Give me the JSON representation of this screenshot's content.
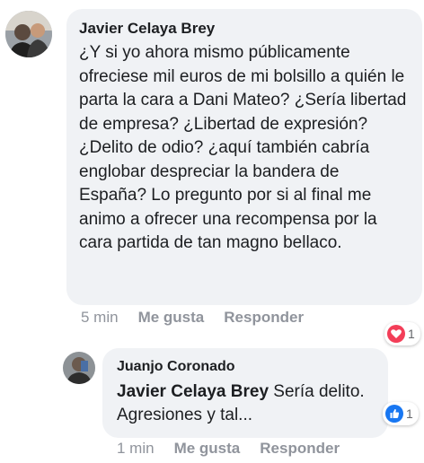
{
  "comments": [
    {
      "author": "Javier Celaya Brey",
      "text": "¿Y si yo ahora mismo públicamente ofreciese mil euros de mi bolsillo a quién le parta la cara a Dani Mateo? ¿Sería libertad de empresa? ¿Libertad de expresión? ¿Delito de odio? ¿aquí también cabría englobar despreciar la bandera de España? Lo pregunto por si al final me animo a ofrecer una recompensa por la cara partida de tan magno bellaco.",
      "time": "5 min",
      "like_label": "Me gusta",
      "reply_label": "Responder",
      "reaction": {
        "icon": "love-reaction-icon",
        "color": "#f33e58",
        "count": "1"
      }
    },
    {
      "author": "Juanjo Coronado",
      "mention": "Javier Celaya Brey",
      "text": " Sería delito. Agresiones y tal...",
      "time": "1 min",
      "like_label": "Me gusta",
      "reply_label": "Responder",
      "reaction": {
        "icon": "like-reaction-icon",
        "color": "#1877f2",
        "count": "1"
      }
    }
  ]
}
